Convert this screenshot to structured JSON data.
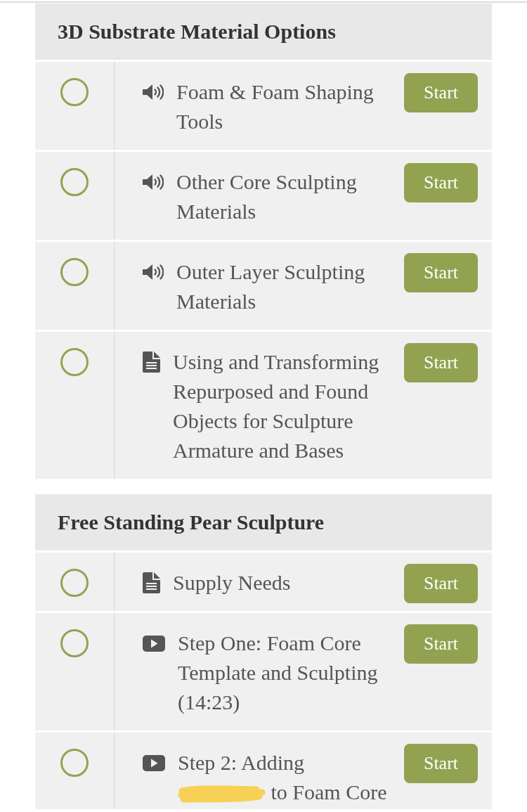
{
  "sections": [
    {
      "title": "3D Substrate Material Options",
      "lessons": [
        {
          "kind": "audio",
          "title": "Foam & Foam Shaping Tools",
          "redacted": false,
          "completed": false,
          "button": "Start"
        },
        {
          "kind": "audio",
          "title": "Other Core Sculpting Materials",
          "redacted": false,
          "completed": false,
          "button": "Start"
        },
        {
          "kind": "audio",
          "title": "Outer Layer Sculpting Materials",
          "redacted": false,
          "completed": false,
          "button": "Start"
        },
        {
          "kind": "document",
          "title": "Using and Transforming Repurposed and Found Objects for Sculpture Armature and Bases",
          "redacted": false,
          "completed": false,
          "button": "Start"
        }
      ]
    },
    {
      "title": "Free Standing Pear Sculpture",
      "lessons": [
        {
          "kind": "document",
          "title": "Supply Needs",
          "redacted": false,
          "completed": false,
          "button": "Start"
        },
        {
          "kind": "video",
          "title": "Step One: Foam Core Template and Sculpting (14:23)",
          "redacted": false,
          "completed": false,
          "button": "Start"
        },
        {
          "kind": "video",
          "title": "Step 2: Adding",
          "redacted": true,
          "title_after": "to Foam Core",
          "completed": false,
          "button": "Start"
        }
      ]
    }
  ]
}
